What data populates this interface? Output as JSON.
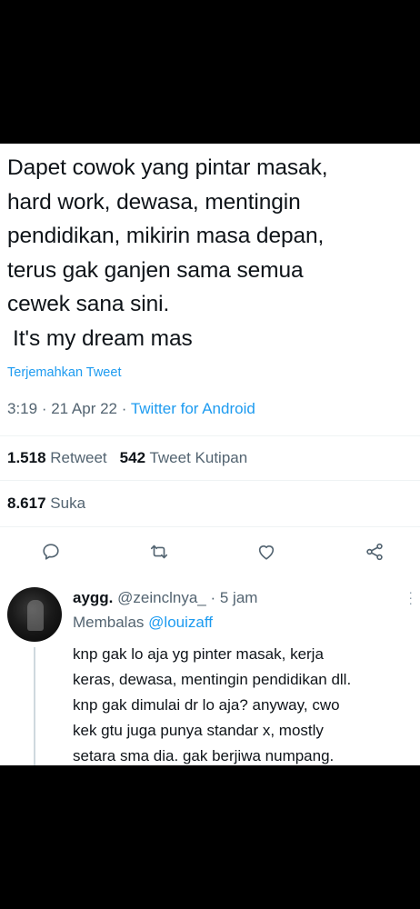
{
  "tweet": {
    "text_lines": [
      "Dapet cowok yang pintar masak,",
      "hard work, dewasa, mentingin",
      "pendidikan, mikirin masa depan,",
      "terus gak ganjen sama semua",
      "cewek sana sini.",
      "It's my dream mas"
    ],
    "translate_label": "Terjemahkan Tweet",
    "time": "3:19",
    "date": "21 Apr 22",
    "client": "Twitter for Android",
    "retweet_count": "1.518",
    "retweet_label": "Retweet",
    "quote_count": "542",
    "quote_label": "Tweet Kutipan",
    "like_count": "8.617",
    "like_label": "Suka"
  },
  "actions": {
    "reply_icon": "comment-icon",
    "retweet_icon": "retweet-icon",
    "like_icon": "heart-icon",
    "share_icon": "share-icon"
  },
  "reply": {
    "name": "aygg.",
    "handle": "@zeinclnya_",
    "age": "5 jam",
    "replying_label": "Membalas",
    "replying_to": "@louizaff",
    "text_lines": [
      "knp gak lo aja yg pinter masak, kerja",
      "keras, dewasa, mentingin pendidikan dll.",
      "knp gak dimulai dr lo aja? anyway, cwo",
      "kek gtu juga punya standar x, mostly",
      "setara sma dia. gak berjiwa numpang."
    ]
  },
  "colors": {
    "link": "#1d9bf0",
    "secondary_text": "#536471",
    "primary_text": "#0f1419",
    "background": "#ffffff",
    "letterbox": "#000000"
  }
}
